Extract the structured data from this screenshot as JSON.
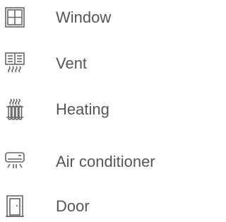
{
  "items": [
    {
      "label": "Window",
      "icon": "window-icon"
    },
    {
      "label": "Vent",
      "icon": "vent-icon"
    },
    {
      "label": "Heating",
      "icon": "heating-icon"
    },
    {
      "label": "Air conditioner",
      "icon": "air-conditioner-icon"
    },
    {
      "label": "Door",
      "icon": "door-icon"
    }
  ],
  "colors": {
    "text": "#555555",
    "icon_stroke": "#666666",
    "background": "#ffffff"
  }
}
